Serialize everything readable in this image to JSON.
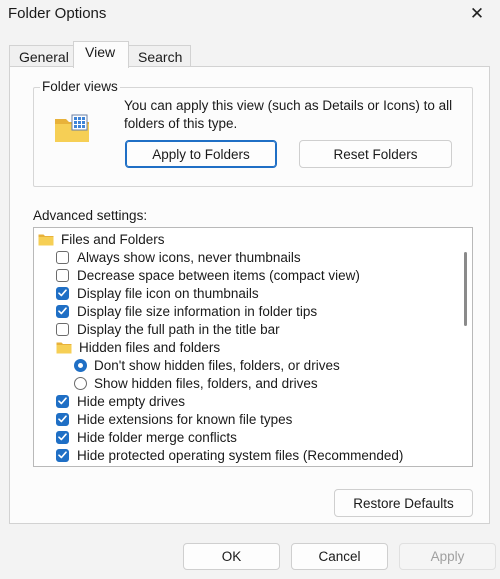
{
  "window": {
    "title": "Folder Options",
    "close_glyph": "✕"
  },
  "tabs": [
    {
      "label": "General"
    },
    {
      "label": "View"
    },
    {
      "label": "Search"
    }
  ],
  "active_tab": "View",
  "folder_views": {
    "legend": "Folder views",
    "description": "You can apply this view (such as Details or Icons) to all folders of this type.",
    "icon": "folder-views-icon",
    "apply_label": "Apply to Folders",
    "reset_label": "Reset Folders"
  },
  "advanced": {
    "label": "Advanced settings:",
    "items": [
      {
        "type": "folder",
        "text": "Files and Folders",
        "indent": 0
      },
      {
        "type": "checkbox",
        "text": "Always show icons, never thumbnails",
        "checked": false,
        "indent": 1
      },
      {
        "type": "checkbox",
        "text": "Decrease space between items (compact view)",
        "checked": false,
        "indent": 1
      },
      {
        "type": "checkbox",
        "text": "Display file icon on thumbnails",
        "checked": true,
        "indent": 1
      },
      {
        "type": "checkbox",
        "text": "Display file size information in folder tips",
        "checked": true,
        "indent": 1
      },
      {
        "type": "checkbox",
        "text": "Display the full path in the title bar",
        "checked": false,
        "indent": 1
      },
      {
        "type": "folder",
        "text": "Hidden files and folders",
        "indent": 1
      },
      {
        "type": "radio",
        "text": "Don't show hidden files, folders, or drives",
        "checked": true,
        "indent": 2
      },
      {
        "type": "radio",
        "text": "Show hidden files, folders, and drives",
        "checked": false,
        "indent": 2
      },
      {
        "type": "checkbox",
        "text": "Hide empty drives",
        "checked": true,
        "indent": 1
      },
      {
        "type": "checkbox",
        "text": "Hide extensions for known file types",
        "checked": true,
        "indent": 1
      },
      {
        "type": "checkbox",
        "text": "Hide folder merge conflicts",
        "checked": true,
        "indent": 1
      },
      {
        "type": "checkbox",
        "text": "Hide protected operating system files (Recommended)",
        "checked": true,
        "indent": 1
      }
    ],
    "restore_label": "Restore Defaults"
  },
  "footer": {
    "ok_label": "OK",
    "cancel_label": "Cancel",
    "apply_label": "Apply"
  },
  "colors": {
    "accent": "#1f6fc5",
    "background": "#f3f3f3",
    "panel": "#fcfcfc"
  }
}
